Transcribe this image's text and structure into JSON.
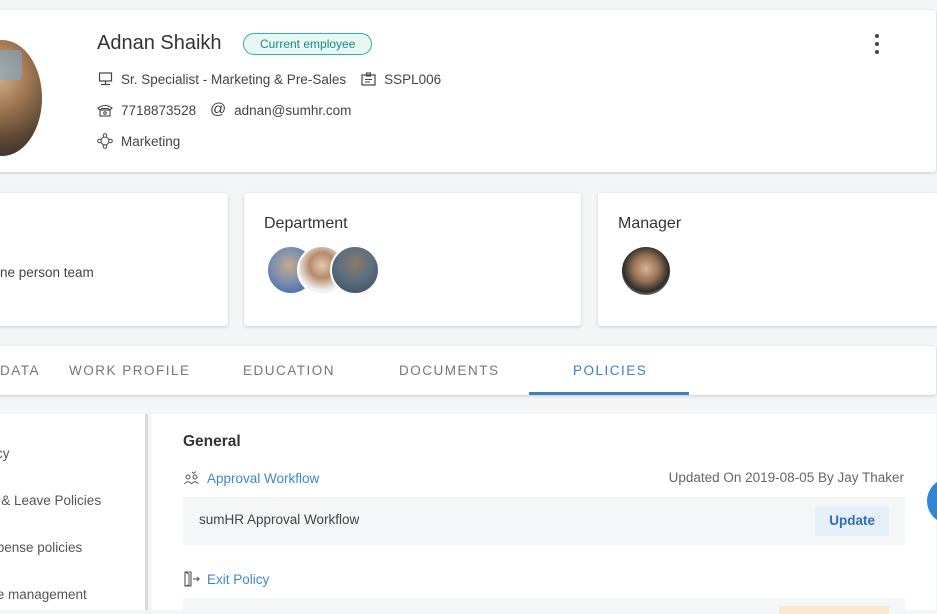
{
  "profile": {
    "name": "Adnan Shaikh",
    "status": "Current employee",
    "designation": "Sr. Specialist - Marketing & Pre-Sales",
    "employee_id": "SSPL006",
    "phone": "7718873528",
    "email": "adnan@sumhr.com",
    "department": "Marketing"
  },
  "summary": {
    "team_text": "ne person team",
    "department_title": "Department",
    "manager_title": "Manager"
  },
  "tabs": [
    {
      "label": "DATA"
    },
    {
      "label": "WORK PROFILE"
    },
    {
      "label": "EDUCATION"
    },
    {
      "label": "DOCUMENTS"
    },
    {
      "label": "POLICIES",
      "active": true
    }
  ],
  "sidebar": {
    "items": [
      {
        "label": "licy"
      },
      {
        "label": "e & Leave Policies"
      },
      {
        "label": "xpense policies"
      },
      {
        "label": "ce management"
      }
    ]
  },
  "policies": {
    "section_title": "General",
    "approval": {
      "link": "Approval Workflow",
      "updated": "Updated On 2019-08-05 By Jay Thaker",
      "row_name": "sumHR Approval Workflow",
      "button": "Update"
    },
    "exit": {
      "link": "Exit Policy"
    }
  },
  "colors": {
    "accent": "#3f7fbf",
    "status_border": "#2bb3a3",
    "link": "#3f88c8"
  }
}
